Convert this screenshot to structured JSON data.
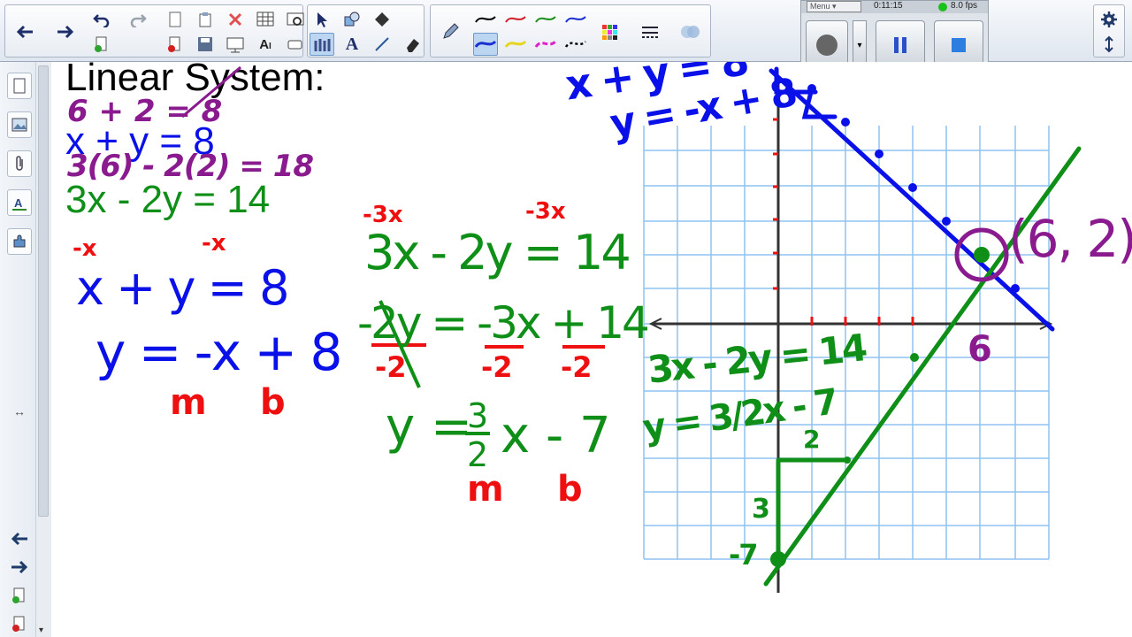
{
  "toolbar": {
    "back_icon": "arrow-left-icon",
    "forward_icon": "arrow-right-icon",
    "pen_colors": [
      "#000000",
      "#d01f2a",
      "#1a8f1a",
      "#1a2fd0"
    ],
    "highlighter_colors": [
      "#1a2fd0",
      "#e6d51a",
      "#e020c8",
      "#000000"
    ]
  },
  "recorder": {
    "menu_label": "Menu",
    "time": "0:11:15",
    "fps": "8.0 fps",
    "status_color": "#19c219"
  },
  "whiteboard": {
    "title": "Linear System:",
    "equation1": "x + y = 8",
    "equation2": "3x - 2y = 14",
    "colors": {
      "blue": "#0a10e8",
      "green": "#0f8f18",
      "red": "#ee1010",
      "purple": "#8a1b8f"
    },
    "ink": {
      "check1": "6 + 2 = 8",
      "check2": "3(6) - 2(2) = 18",
      "minus_x": "-x",
      "eq1_line": "x + y = 8",
      "eq1_solved": "y = -x + 8",
      "m1": "m",
      "b1": "b",
      "minus_3x": "-3x",
      "eq2_line": "3x - 2y = 14",
      "eq2_step": "-2y = -3x + 14",
      "divisor": "-2",
      "eq2_solved_left": "y =",
      "frac_num": "3",
      "frac_den": "2",
      "eq2_solved_right": "x - 7",
      "m2": "m",
      "b2": "b",
      "graph_eq1": "x + y = 8",
      "graph_eq1b": "y = -x + 8",
      "graph_eq2": "3x - 2y = 14",
      "graph_eq2b": "y = 3/2x - 7",
      "intersection": "(6, 2)",
      "six": "6",
      "run_label": "2",
      "rise_label": "3",
      "intercept_label": "-7"
    }
  }
}
